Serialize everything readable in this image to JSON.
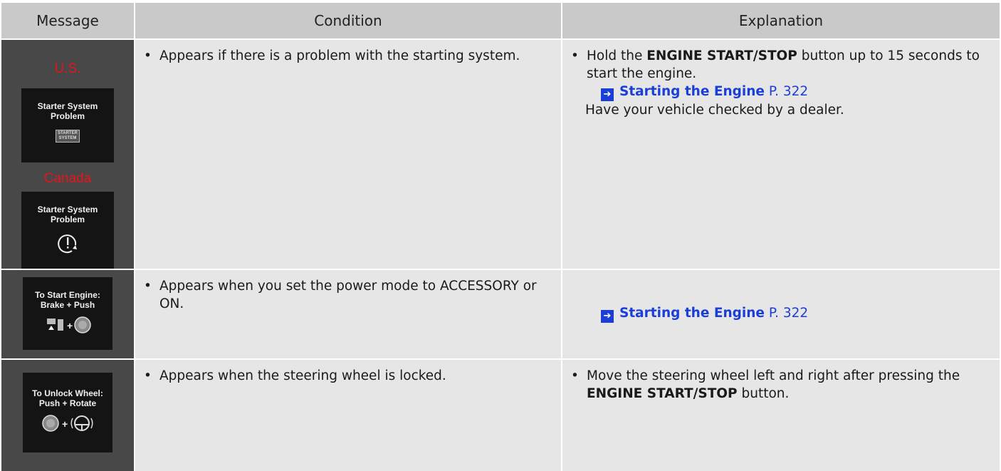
{
  "headers": {
    "message": "Message",
    "condition": "Condition",
    "explanation": "Explanation"
  },
  "rows": [
    {
      "message": {
        "us_label": "U.S.",
        "us_display_line1": "Starter System",
        "us_display_line2": "Problem",
        "us_icon_line1": "STARTER",
        "us_icon_line2": "SYSTEM",
        "ca_label": "Canada",
        "ca_display_line1": "Starter System",
        "ca_display_line2": "Problem"
      },
      "condition": "Appears if there is a problem with the starting system.",
      "explanation": {
        "pre": "Hold the ",
        "bold": "ENGINE START/STOP",
        "post": " button up to 15 seconds to start the engine.",
        "link_text": "Starting the Engine",
        "link_page": "P. 322",
        "after": "Have your vehicle checked by a dealer."
      }
    },
    {
      "message": {
        "display_line1": "To Start Engine:",
        "display_line2": "Brake + Push"
      },
      "condition": "Appears when you set the power mode to ACCESSORY or ON.",
      "explanation": {
        "link_text": "Starting the Engine",
        "link_page": "P. 322"
      }
    },
    {
      "message": {
        "display_line1": "To Unlock Wheel:",
        "display_line2": "Push + Rotate"
      },
      "condition": "Appears when the steering wheel is locked.",
      "explanation": {
        "pre": "Move the steering wheel left and right after pressing the ",
        "bold": "ENGINE START/STOP",
        "post": " button."
      }
    }
  ],
  "icons": {
    "bullet": "•",
    "arrow": "arrow-right-icon",
    "plus": "+"
  },
  "colors": {
    "region_label": "#e3151c",
    "link": "#1a3ed6",
    "header_bg": "#c9c9c9",
    "cell_bg": "#e6e6e6"
  }
}
